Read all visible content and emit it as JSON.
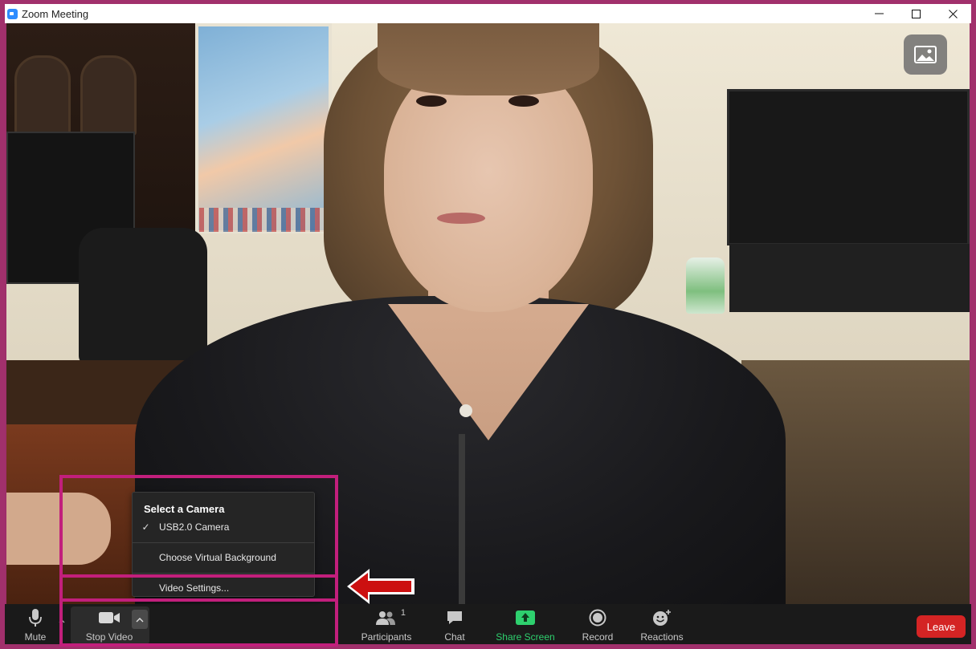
{
  "window": {
    "title": "Zoom Meeting",
    "controls": {
      "minimize": "—",
      "maximize": "☐",
      "close": "✕"
    }
  },
  "toolbar": {
    "mute_label": "Mute",
    "stop_video_label": "Stop Video",
    "participants_label": "Participants",
    "participants_count": "1",
    "chat_label": "Chat",
    "share_screen_label": "Share Screen",
    "record_label": "Record",
    "reactions_label": "Reactions",
    "leave_label": "Leave"
  },
  "camera_menu": {
    "header": "Select a Camera",
    "camera_option": "USB2.0 Camera",
    "camera_selected": true,
    "virtual_background": "Choose Virtual Background",
    "video_settings": "Video Settings..."
  },
  "colors": {
    "border_accent": "#a1306c",
    "highlight": "#c21f7c",
    "share_green": "#2ed06e",
    "leave_red": "#d42424",
    "arrow_red": "#cc1010"
  }
}
